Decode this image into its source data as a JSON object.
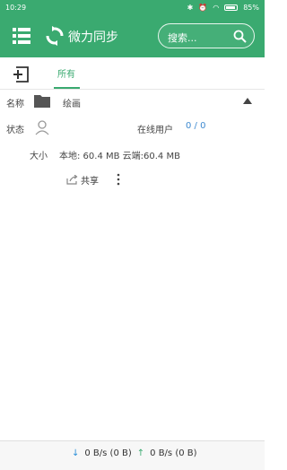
{
  "status_bar": {
    "time": "10:29",
    "battery": "85%"
  },
  "app_bar": {
    "title": "微力同步",
    "search_placeholder": "搜索..."
  },
  "tabs": {
    "all": "所有"
  },
  "folder": {
    "name_label": "名称",
    "name": "绘画",
    "status_label": "状态",
    "online_users_label": "在线用户",
    "online_users": "0 / 0",
    "size_label": "大小",
    "size_value": "本地: 60.4 MB 云端:60.4 MB",
    "share_label": "共享"
  },
  "bottom": {
    "download_speed": "0 B/s (0 B)",
    "upload_speed": "0 B/s (0 B)"
  },
  "colors": {
    "accent": "#3aaa70",
    "link_blue": "#3f8ad0"
  }
}
